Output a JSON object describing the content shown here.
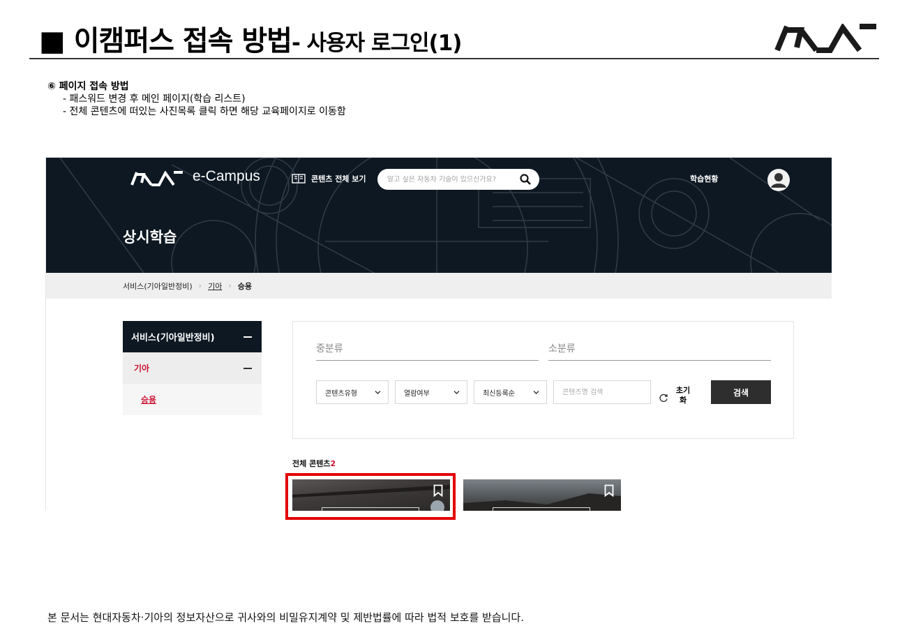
{
  "slide": {
    "title_main": "■ 이캠퍼스 접속 방법",
    "title_sub": "- 사용자 로그인(1)",
    "step_heading": "⑥ 페이지 접속 방법",
    "step_lines": [
      "- 패스워드 변경 후 메인 페이지(학습 리스트)",
      "- 전체 콘텐츠에 떠있는 사진목록 클릭 하면 해당 교육페이지로 이동함"
    ],
    "footer": "본 문서는 현대자동차·기아의 정보자산으로 귀사와의 비밀유지계약 및 제반법률에 따라 법적 보호를 받습니다.",
    "logo_icon": "kia-logo-icon",
    "rule_color": "#333333"
  },
  "app": {
    "brand": "e-Campus",
    "catalog_label": "콘텐츠 전체 보기",
    "search_placeholder": "알고 싶은 자동차 기술이 있으신가요?",
    "status_label": "학습현황",
    "page_title": "상시학습",
    "breadcrumb": [
      "서비스(기아일반정비)",
      "기아",
      "승용"
    ],
    "menu": {
      "level1": "서비스(기아일반정비)",
      "level2": "기아",
      "level3": "승용"
    },
    "filter": {
      "mid_category": "중분류",
      "sub_category": "소분류",
      "content_type": "콘텐츠유형",
      "view_status": "열람여부",
      "sort": "최신등록순",
      "keyword_placeholder": "콘텐츠명 검색",
      "reset_label_1": "초기",
      "reset_label_2": "화",
      "search_button": "검색"
    },
    "total_label": "전체 콘텐츠",
    "total_count": "2",
    "colors": {
      "header_bg": "#0d1822",
      "accent_red": "#c8102e",
      "highlight": "#e30000",
      "search_button": "#2e2e2e"
    }
  }
}
